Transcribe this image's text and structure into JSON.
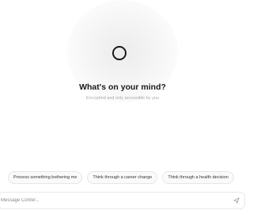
{
  "hero": {
    "title": "What's on your mind?",
    "subtitle": "Encrypted and only accessible by you"
  },
  "suggestions": [
    {
      "label": "Process something bothering me"
    },
    {
      "label": "Think through a career change"
    },
    {
      "label": "Think through a health decision"
    }
  ],
  "composer": {
    "placeholder": "Message Confer..."
  },
  "icons": {
    "logo": "ring-logo-icon",
    "send": "send-arrow-icon"
  },
  "colors": {
    "text_primary": "#1a1a1a",
    "text_muted": "#a8a8a8",
    "chip_border": "#e6e6e6"
  }
}
